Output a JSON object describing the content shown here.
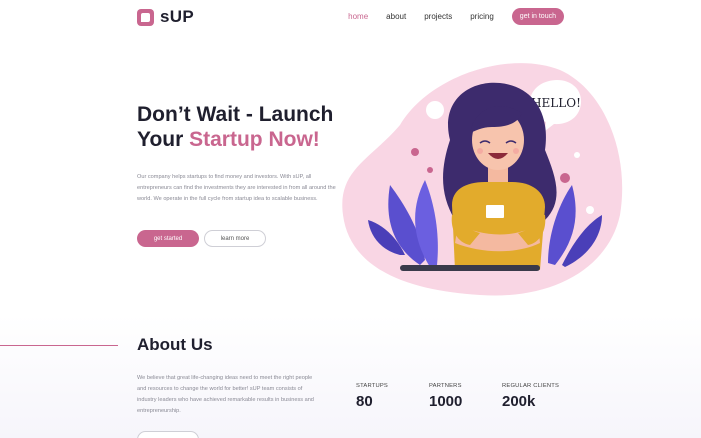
{
  "brand": {
    "name": "sUP"
  },
  "nav": {
    "items": [
      {
        "label": "home",
        "active": true
      },
      {
        "label": "about",
        "active": false
      },
      {
        "label": "projects",
        "active": false
      },
      {
        "label": "pricing",
        "active": false
      }
    ],
    "cta_label": "get in touch"
  },
  "hero": {
    "title_line1": "Don’t Wait - Launch",
    "title_line2_prefix": "Your ",
    "title_line2_accent": "Startup Now!",
    "description": "Our company helps startups to find money and investors. With sUP, all entrepreneurs can find the investments they are interested in from all around the world. We operate in the full cycle from startup idea to scalable business.",
    "primary_button": "get started",
    "secondary_button": "learn more",
    "bubble_text": "HELLO!"
  },
  "about": {
    "title": "About Us",
    "description": "We believe that great life-changing ideas need to meet the right people and resources to change the world for better! sUP team consists of industry leaders who have achieved remarkable results in business and entrepreneurship.",
    "stats": [
      {
        "label": "STARTUPS",
        "value": "80"
      },
      {
        "label": "PARTNERS",
        "value": "1000"
      },
      {
        "label": "REGULAR CLIENTS",
        "value": "200k"
      }
    ]
  },
  "colors": {
    "accent": "#c9668f",
    "blob": "#f9d6e4",
    "shirt": "#e2ab2c",
    "hair": "#3d2b6d",
    "leaves": "#5a4fcf"
  }
}
